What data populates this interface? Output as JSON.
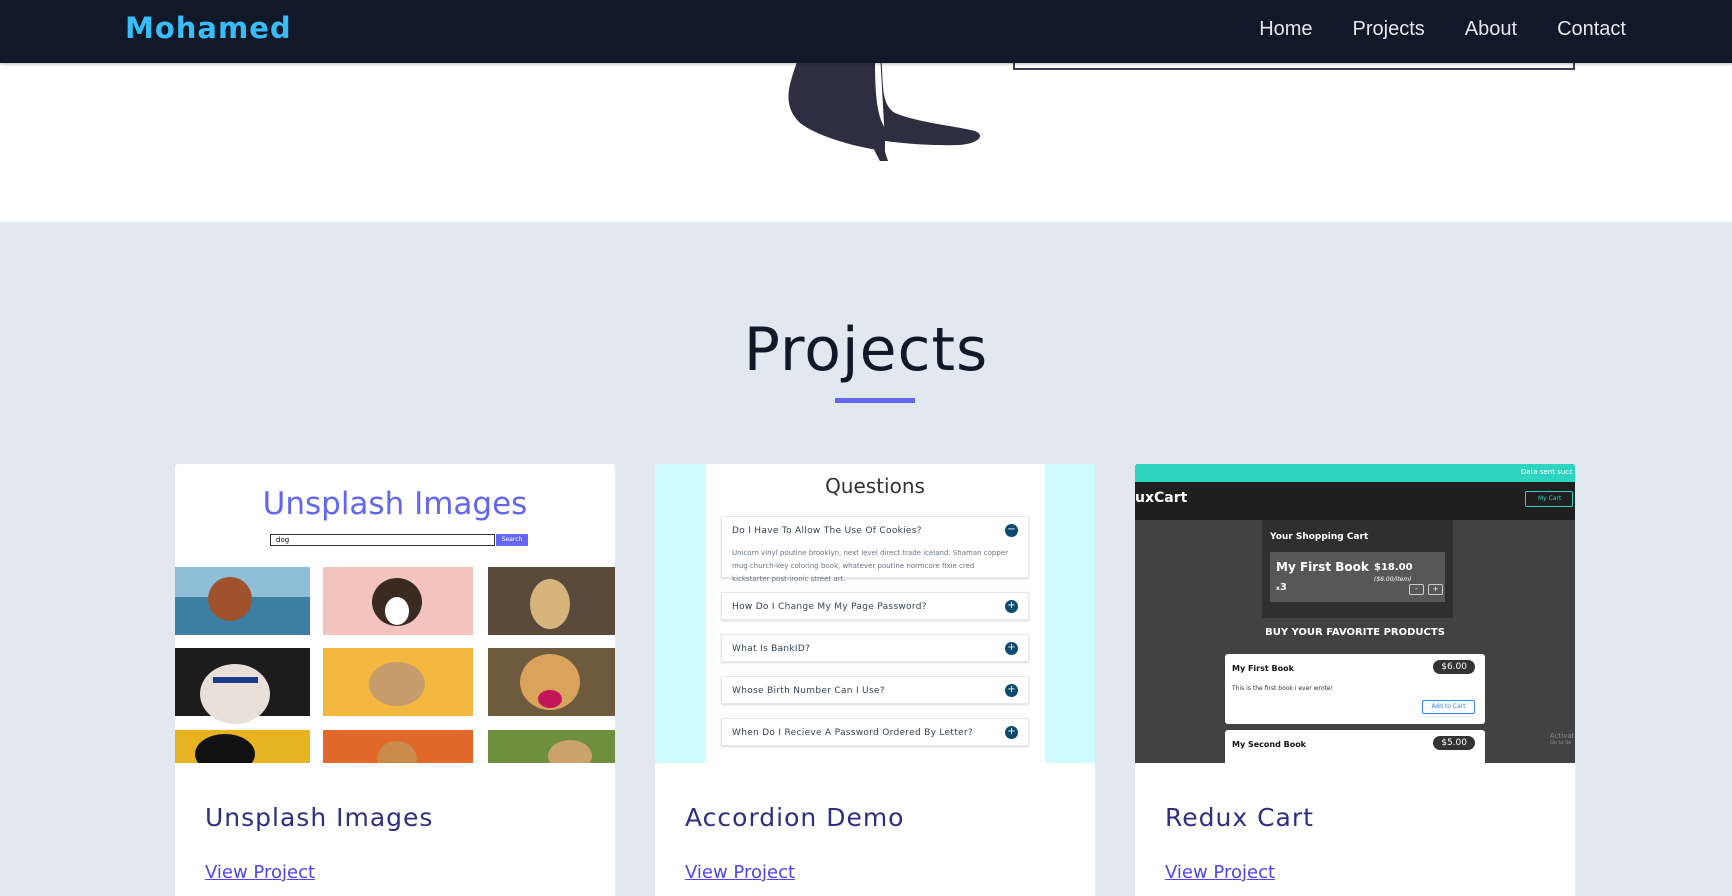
{
  "nav": {
    "brand": "Mohamed",
    "links": [
      "Home",
      "Projects",
      "About",
      "Contact"
    ]
  },
  "projects": {
    "title": "Projects",
    "accent_color": "#6366f1",
    "cards": [
      {
        "title": "Unsplash Images",
        "link": "View Project",
        "thumb": {
          "heading": "Unsplash Images",
          "search_value": "dog",
          "search_button": "Search"
        }
      },
      {
        "title": "Accordion Demo",
        "link": "View Project",
        "thumb": {
          "heading": "Questions",
          "questions": [
            "Do I Have To Allow The Use Of Cookies?",
            "How Do I Change My My Page Password?",
            "What Is BankID?",
            "Whose Birth Number Can I Use?",
            "When Do I Recieve A Password Ordered By Letter?"
          ],
          "open_answer": "Unicorn vinyl poutine brooklyn, next level direct trade iceland. Shaman copper mug church-key coloring book, whatever poutine normcore fixie cred kickstarter post-ironic street art.",
          "open_icon": "−",
          "closed_icon": "+"
        }
      },
      {
        "title": "Redux Cart",
        "link": "View Project",
        "thumb": {
          "notification": "Data sent succ",
          "logo": "uxCart",
          "my_cart": "My Cart",
          "cart_heading": "Your Shopping Cart",
          "cart_item": {
            "name": "My First Book",
            "total": "$18.00",
            "unit": "($6.00/item)",
            "qty_prefix": "x",
            "qty": "3",
            "minus": "-",
            "plus": "+"
          },
          "products_heading": "BUY YOUR FAVORITE PRODUCTS",
          "products": [
            {
              "name": "My First Book",
              "price": "$6.00",
              "desc": "This is the first book i ever wrote!",
              "button": "Add to Cart"
            },
            {
              "name": "My Second Book",
              "price": "$5.00"
            }
          ],
          "watermark_1": "Activat",
          "watermark_2": "Go to Se"
        }
      }
    ]
  }
}
